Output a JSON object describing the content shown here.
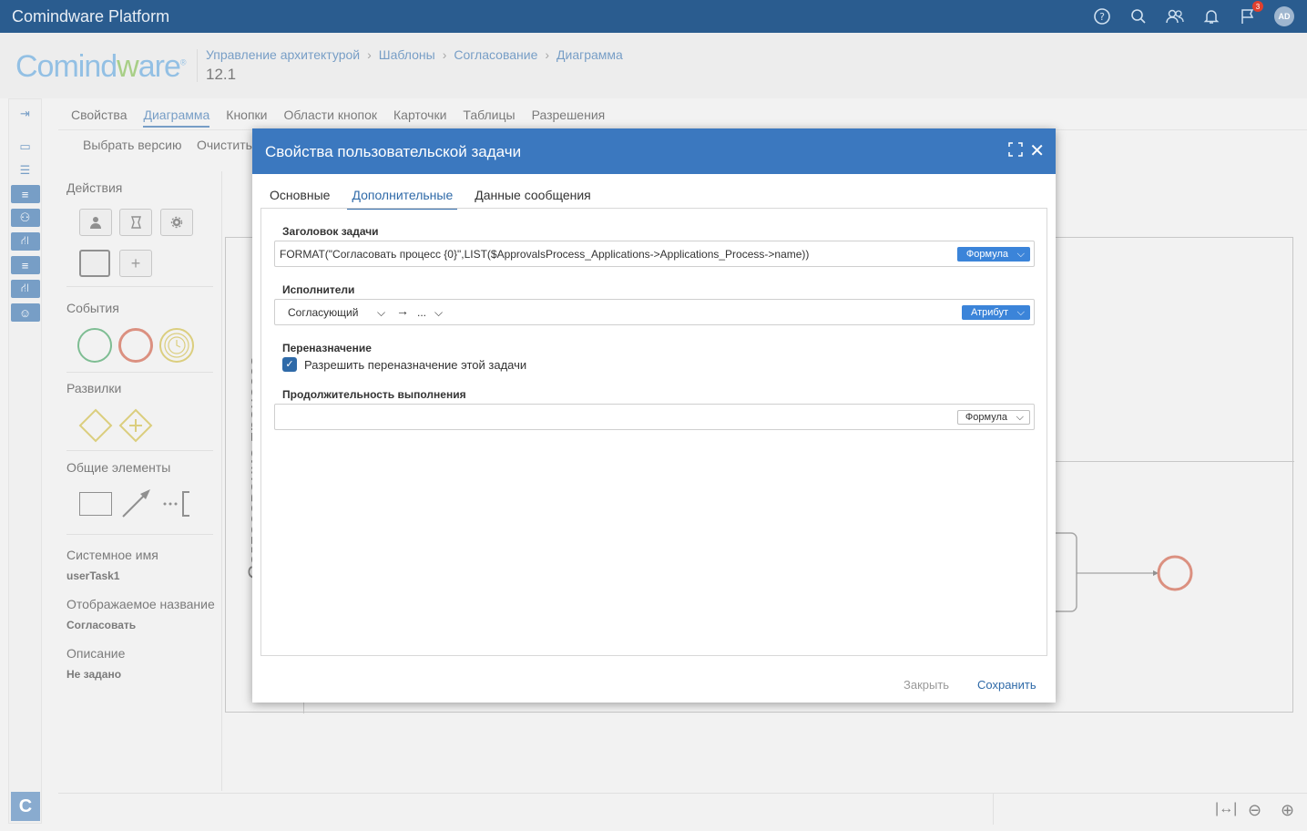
{
  "topbar": {
    "app_title": "Comindware Platform",
    "notification_count": "3",
    "avatar_initials": "AD",
    "icons": [
      "help-icon",
      "search-icon",
      "users-icon",
      "bell-icon",
      "flag-icon"
    ]
  },
  "header": {
    "logo_a": "Comind",
    "logo_b": "w",
    "logo_c": "are",
    "breadcrumb": [
      "Управление архитектурой",
      "Шаблоны",
      "Согласование",
      "Диаграмма"
    ],
    "version": "12.1"
  },
  "tabs": [
    "Свойства",
    "Диаграмма",
    "Кнопки",
    "Области кнопок",
    "Карточки",
    "Таблицы",
    "Разрешения"
  ],
  "toolbar": {
    "select_version": "Выбрать версию",
    "clear": "Очистить"
  },
  "palette": {
    "actions_title": "Действия",
    "events_title": "События",
    "gateways_title": "Развилки",
    "common_title": "Общие элементы",
    "system_name_label": "Системное имя",
    "system_name_value": "userTask1",
    "display_name_label": "Отображаемое название",
    "display_name_value": "Согласовать",
    "description_label": "Описание",
    "description_value": "Не задано"
  },
  "canvas": {
    "lane_title": "Согласование процесса"
  },
  "dialog": {
    "title": "Свойства пользовательской задачи",
    "tabs": [
      "Основные",
      "Дополнительные",
      "Данные сообщения"
    ],
    "task_header_label": "Заголовок задачи",
    "task_header_value": "FORMAT(\"Согласовать процесс {0}\",LIST($ApprovalsProcess_Applications->Applications_Process->name))",
    "task_header_mode": "Формула",
    "performers_label": "Исполнители",
    "performers_value": "Согласующий",
    "performers_arrow": "→",
    "performers_more": "...",
    "performers_mode": "Атрибут",
    "reassign_label": "Переназначение",
    "reassign_checkbox_label": "Разрешить переназначение этой задачи",
    "reassign_checked": true,
    "duration_label": "Продолжительность выполнения",
    "duration_mode": "Формула",
    "close_button": "Закрыть",
    "save_button": "Сохранить"
  },
  "colors": {
    "topbar": "#2a5c8f",
    "accent": "#2f6aa8",
    "dialog_header": "#3b78bf",
    "start_event": "#3a9a5a",
    "end_event": "#c8553d",
    "timer_event": "#c8b43a",
    "gateway": "#c8b43a"
  }
}
